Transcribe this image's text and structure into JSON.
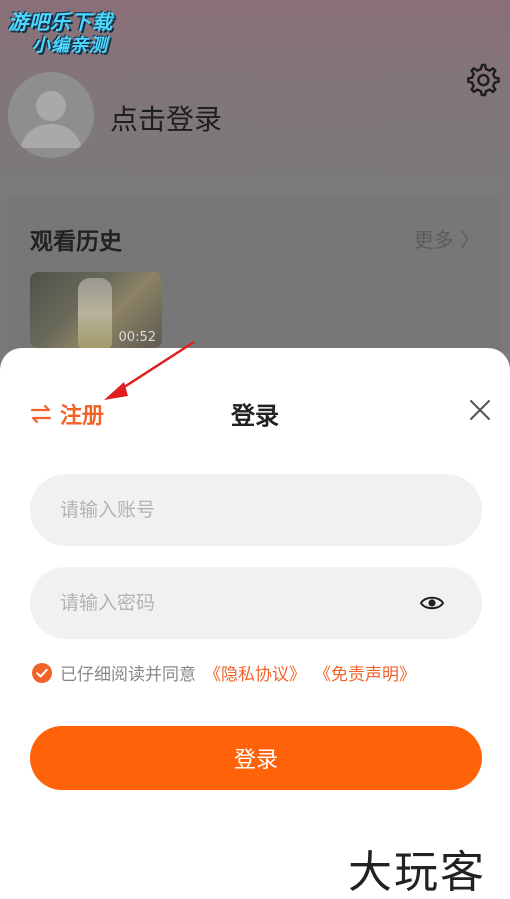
{
  "watermark_top": {
    "line1": "游吧乐下载",
    "line2": "小编亲测"
  },
  "profile": {
    "login_prompt": "点击登录"
  },
  "history": {
    "title": "观看历史",
    "more": "更多 〉",
    "items": [
      {
        "duration": "00:52"
      }
    ]
  },
  "sheet": {
    "switch_label": "注册",
    "title": "登录",
    "account_placeholder": "请输入账号",
    "password_placeholder": "请输入密码",
    "agree_prefix": "已仔细阅读并同意",
    "privacy_link": "《隐私协议》",
    "disclaimer_link": "《免责声明》",
    "login_button": "登录"
  },
  "watermark_bottom": "大玩客",
  "colors": {
    "accent": "#ff6209",
    "link": "#f2632a",
    "arrow": "#e02020"
  },
  "icons": [
    "gear-icon",
    "avatar-icon",
    "chevron-right-icon",
    "switch-arrows-icon",
    "close-icon",
    "eye-icon",
    "check-icon"
  ]
}
